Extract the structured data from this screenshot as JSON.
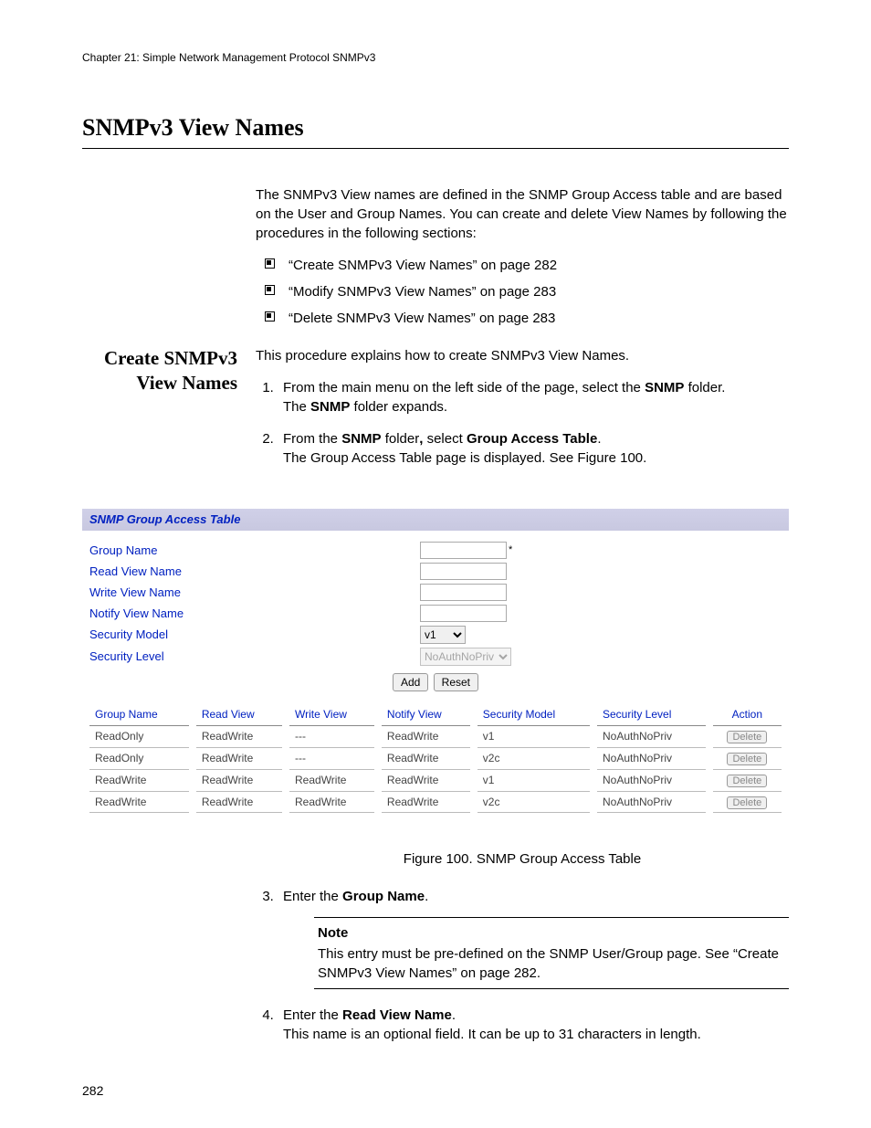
{
  "header": {
    "chapter": "Chapter 21: Simple Network Management Protocol SNMPv3"
  },
  "title": "SNMPv3 View Names",
  "intro": "The SNMPv3 View names are defined in the SNMP Group Access table and are based on the User and Group Names. You can create and delete View Names by following the procedures in the following sections:",
  "bullets": [
    "“Create SNMPv3 View Names” on page 282",
    "“Modify SNMPv3 View Names” on page 283",
    "“Delete SNMPv3 View Names” on page 283"
  ],
  "subheading": "Create SNMPv3 View Names",
  "sub_intro": "This procedure explains how to create SNMPv3 View Names.",
  "step1_a": "From the main menu on the left side of the page, select the ",
  "step1_bold": "SNMP",
  "step1_b": " folder.",
  "step1_c_a": "The ",
  "step1_c_bold": "SNMP",
  "step1_c_b": " folder expands.",
  "step2_a": "From the ",
  "step2_bold1": "SNMP",
  "step2_b": " folder",
  "step2_c": " select ",
  "step2_bold2": "Group Access Table",
  "step2_d": ".",
  "step2_e": "The Group Access Table page is displayed. See Figure 100.",
  "figure": {
    "title": "SNMP Group Access Table",
    "form": {
      "labels": {
        "group_name": "Group Name",
        "read_view": "Read View Name",
        "write_view": "Write View Name",
        "notify_view": "Notify View Name",
        "sec_model": "Security Model",
        "sec_level": "Security Level"
      },
      "sec_model_value": "v1",
      "sec_level_value": "NoAuthNoPriv",
      "add_btn": "Add",
      "reset_btn": "Reset"
    },
    "table": {
      "headers": [
        "Group Name",
        "Read View",
        "Write View",
        "Notify View",
        "Security Model",
        "Security Level",
        "Action"
      ],
      "rows": [
        [
          "ReadOnly",
          "ReadWrite",
          "---",
          "ReadWrite",
          "v1",
          "NoAuthNoPriv"
        ],
        [
          "ReadOnly",
          "ReadWrite",
          "---",
          "ReadWrite",
          "v2c",
          "NoAuthNoPriv"
        ],
        [
          "ReadWrite",
          "ReadWrite",
          "ReadWrite",
          "ReadWrite",
          "v1",
          "NoAuthNoPriv"
        ],
        [
          "ReadWrite",
          "ReadWrite",
          "ReadWrite",
          "ReadWrite",
          "v2c",
          "NoAuthNoPriv"
        ]
      ],
      "delete_label": "Delete"
    }
  },
  "fig_caption": "Figure 100. SNMP Group Access Table",
  "step3_a": "Enter the ",
  "step3_bold": "Group Name",
  "step3_b": ".",
  "note": {
    "title": "Note",
    "body": "This entry must be pre-defined on the SNMP User/Group page. See “Create SNMPv3 View Names” on page 282."
  },
  "step4_a": "Enter the ",
  "step4_bold": "Read View Name",
  "step4_b": ".",
  "step4_c": "This name is an optional field. It can be up to 31 characters in length.",
  "page_number": "282"
}
